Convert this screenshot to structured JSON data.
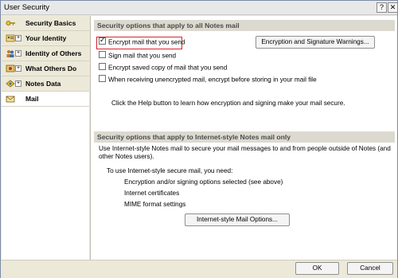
{
  "window": {
    "title": "User Security"
  },
  "titlebar": {
    "help_label": "?",
    "close_label": "✕"
  },
  "sidebar": {
    "items": [
      {
        "label": "Security Basics",
        "icon": "key-icon",
        "expand": ""
      },
      {
        "label": "Your Identity",
        "icon": "id-card-icon",
        "expand": "+"
      },
      {
        "label": "Identity of Others",
        "icon": "people-icon",
        "expand": "+"
      },
      {
        "label": "What Others Do",
        "icon": "shield-icon",
        "expand": "+"
      },
      {
        "label": "Notes Data",
        "icon": "database-icon",
        "expand": "+"
      },
      {
        "label": "Mail",
        "icon": "mail-envelope-icon",
        "expand": "",
        "selected": true
      }
    ]
  },
  "notes_section": {
    "header": "Security options that apply to all Notes mail",
    "checkboxes": [
      {
        "label": "Encrypt mail that you send",
        "checked": true
      },
      {
        "label": "Sign mail that you send",
        "checked": false
      },
      {
        "label": "Encrypt saved copy of mail that you send",
        "checked": false
      },
      {
        "label": "When receiving unencrypted mail, encrypt before storing in your mail file",
        "checked": false
      }
    ],
    "warnings_button": "Encryption and Signature Warnings...",
    "help_text": "Click the Help button to learn how encryption and signing make your mail secure."
  },
  "internet_section": {
    "header": "Security options that apply to Internet-style Notes mail only",
    "intro": "Use Internet-style Notes mail to secure your mail messages to and from people outside of Notes (and other Notes users).",
    "needs_title": "To use Internet-style secure mail, you need:",
    "needs": [
      "Encryption and/or signing options selected (see above)",
      "Internet certificates",
      "MIME format settings"
    ],
    "options_button": "Internet-style Mail Options..."
  },
  "footer": {
    "ok_label": "OK",
    "cancel_label": "Cancel"
  },
  "colors": {
    "highlight": "#d8232a",
    "section_header_bg": "#dcdad0"
  }
}
